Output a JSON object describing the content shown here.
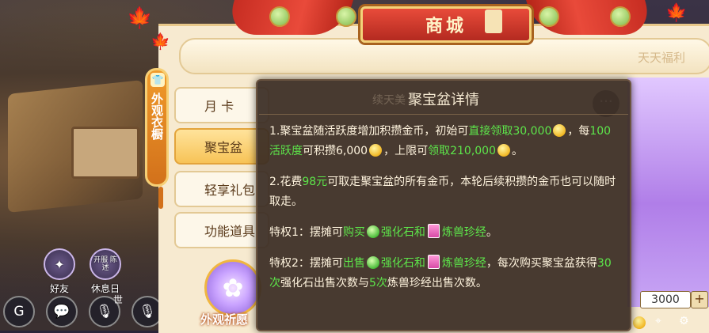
{
  "colors": {
    "highlight": "#5de64a",
    "popup_bg": "#3a2c24",
    "title_red": "#c72d22",
    "tab_active": "#f7c357"
  },
  "shop": {
    "title": "商城",
    "side_tag": "外观衣橱",
    "banner_text": "天天福利"
  },
  "tabs": [
    {
      "label": "月 卡",
      "active": false
    },
    {
      "label": "聚宝盆",
      "active": true
    },
    {
      "label": "轻享礼包",
      "active": false
    },
    {
      "label": "功能道具",
      "active": false
    }
  ],
  "wish": {
    "label": "外观祈愿",
    "icon": "star-flower-icon"
  },
  "game_ui": {
    "friends_label": "好友",
    "rest_label": "休息日",
    "rest_badge": "开服 陈述",
    "world_label": "世"
  },
  "quantity": {
    "value": "3000",
    "plus": "+"
  },
  "popup": {
    "title": "聚宝盆详情",
    "p1": {
      "a": "1.聚宝盆随活跃度增加积攒金币，初始可",
      "b": "直接领取30,000",
      "c": "，每",
      "d": "100活跃度",
      "e": "可积攒6,000",
      "f": "，上限可",
      "g": "领取210,000",
      "h": "。"
    },
    "p2": {
      "a": "2.花费",
      "b": "98元",
      "c": "可取走聚宝盆的所有金币，本轮后续积攒的金币也可以随时取走。"
    },
    "p3": {
      "a": "特权1：摆摊可",
      "b": "购买",
      "c": "强化石和",
      "d": "炼兽珍经",
      "e": "。"
    },
    "p4": {
      "a": "特权2：摆摊可",
      "b": "出售",
      "c": "强化石和",
      "d": "炼兽珍经",
      "e": "，每次购买聚宝盆获得",
      "f": "30次",
      "g": "强化石出售次数与",
      "h": "5次",
      "i": "炼兽珍经出售次数。"
    }
  },
  "behind": {
    "text_fragment": "续天美",
    "more": "···"
  }
}
